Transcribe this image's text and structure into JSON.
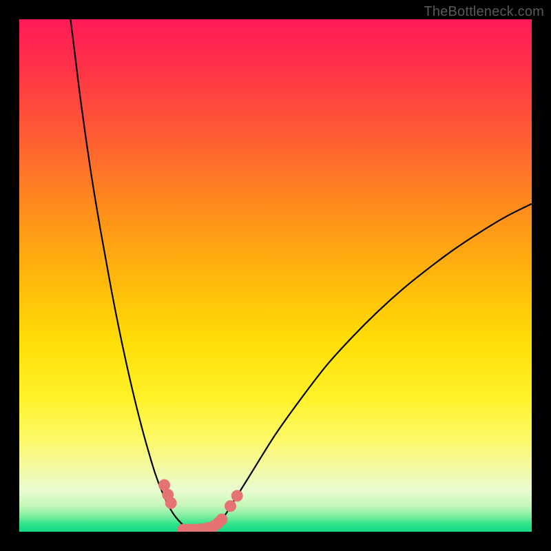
{
  "watermark": "TheBottleneck.com",
  "chart_data": {
    "type": "line",
    "title": "",
    "xlabel": "",
    "ylabel": "",
    "xlim": [
      0,
      100
    ],
    "ylim": [
      0,
      100
    ],
    "grid": false,
    "series": [
      {
        "name": "left-curve",
        "x": [
          10.0,
          11.0,
          12.0,
          14.0,
          16.0,
          18.0,
          20.0,
          22.0,
          24.0,
          26.0,
          27.0,
          28.0,
          29.0,
          30.0,
          31.0,
          32.0,
          33.0,
          34.0
        ],
        "y": [
          100.0,
          92.0,
          84.0,
          70.0,
          58.0,
          47.0,
          37.0,
          28.0,
          20.0,
          13.0,
          10.0,
          7.5,
          5.3,
          3.6,
          2.3,
          1.3,
          0.6,
          0.2
        ]
      },
      {
        "name": "right-curve",
        "x": [
          37.0,
          38.0,
          39.0,
          40.0,
          42.0,
          45.0,
          50.0,
          55.0,
          60.0,
          65.0,
          70.0,
          75.0,
          80.0,
          85.0,
          90.0,
          95.0,
          100.0
        ],
        "y": [
          0.2,
          0.8,
          1.8,
          3.0,
          6.2,
          11.0,
          19.0,
          26.0,
          32.5,
          38.0,
          43.0,
          47.5,
          51.5,
          55.2,
          58.5,
          61.5,
          64.0
        ]
      }
    ],
    "markers": [
      {
        "name": "left-marker-1",
        "x": 28.3,
        "y": 9.1
      },
      {
        "name": "left-marker-2",
        "x": 29.0,
        "y": 7.2
      },
      {
        "name": "left-marker-3",
        "x": 29.6,
        "y": 5.6
      },
      {
        "name": "floor-marker-1",
        "x": 32.0,
        "y": 0.4
      },
      {
        "name": "floor-marker-2",
        "x": 33.0,
        "y": 0.4
      },
      {
        "name": "floor-marker-3",
        "x": 34.0,
        "y": 0.4
      },
      {
        "name": "floor-marker-4",
        "x": 35.0,
        "y": 0.45
      },
      {
        "name": "floor-marker-5",
        "x": 36.0,
        "y": 0.55
      },
      {
        "name": "floor-marker-6",
        "x": 37.0,
        "y": 0.75
      },
      {
        "name": "floor-marker-7",
        "x": 38.0,
        "y": 1.1
      },
      {
        "name": "floor-marker-8",
        "x": 38.8,
        "y": 1.7
      },
      {
        "name": "floor-marker-9",
        "x": 39.5,
        "y": 2.4
      },
      {
        "name": "right-marker-1",
        "x": 41.2,
        "y": 5.0
      },
      {
        "name": "right-marker-2",
        "x": 42.5,
        "y": 7.0
      }
    ],
    "gradient_stops": [
      {
        "pos": 0.0,
        "color": "#ff1a58"
      },
      {
        "pos": 0.5,
        "color": "#ffde07"
      },
      {
        "pos": 0.88,
        "color": "#f3f9a8"
      },
      {
        "pos": 1.0,
        "color": "#18d886"
      }
    ]
  }
}
